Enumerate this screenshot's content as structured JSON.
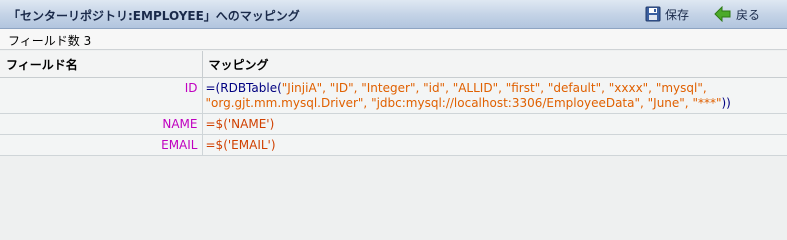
{
  "window": {
    "title": "「センターリポジトリ:EMPLOYEE」へのマッピング",
    "save_label": "保存",
    "back_label": "戻る",
    "save_icon": "floppy-disk-icon",
    "back_icon": "green-left-arrow-icon"
  },
  "summary": {
    "field_count": "フィールド数 3"
  },
  "table": {
    "headers": [
      "フィールド名",
      "マッピング"
    ],
    "rows": [
      {
        "field": "ID",
        "mapping": {
          "prefix": "=(",
          "fn": "RDBTable(",
          "args_line1": "\"JinjiA\", \"ID\", \"Integer\", \"id\", \"ALLID\", \"first\", \"default\", \"xxxx\", \"mysql\",",
          "args_line2": "\"org.gjt.mm.mysql.Driver\", \"jdbc:mysql://localhost:3306/EmployeeData\", \"June\", \"***\"",
          "suffix": "))"
        }
      },
      {
        "field": "NAME",
        "mapping": {
          "prefix": "=$(",
          "arg": "'NAME'",
          "suffix": ")"
        }
      },
      {
        "field": "EMAIL",
        "mapping": {
          "prefix": "=$(",
          "arg": "'EMAIL'",
          "suffix": ")"
        }
      }
    ]
  },
  "colors": {
    "field_name": "#c000c0",
    "operator": "#000080",
    "string": "#e06000",
    "titlebar_top": "#dfe8f2",
    "titlebar_bottom": "#b2c5de"
  }
}
